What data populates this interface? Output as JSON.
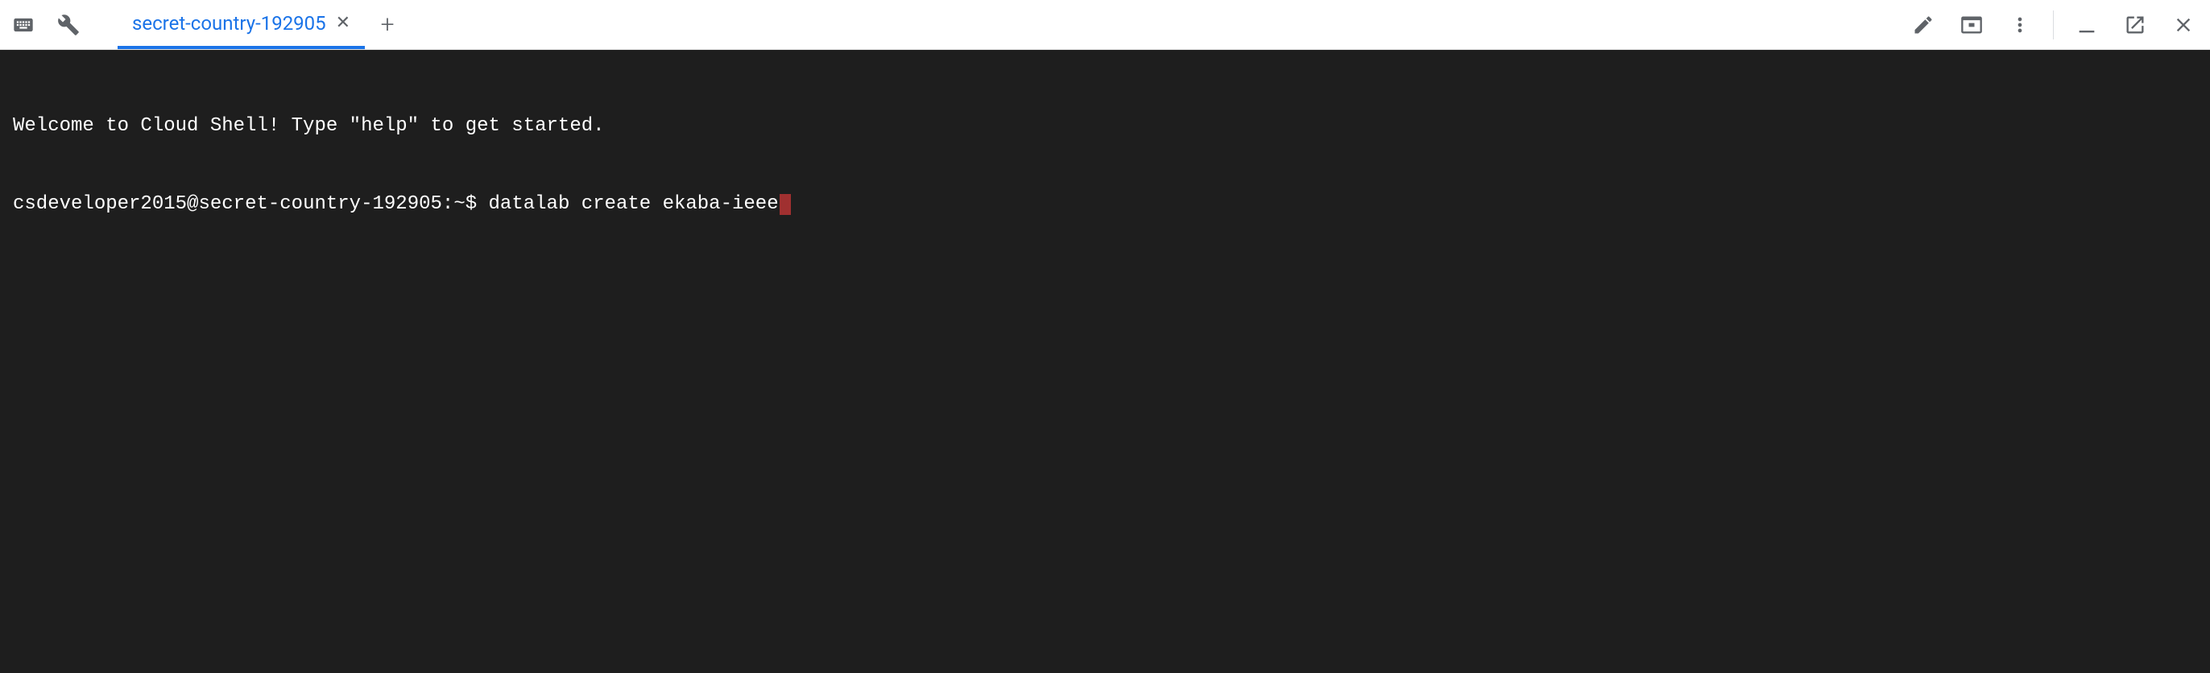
{
  "toolbar": {
    "icons": {
      "keyboard": "keyboard-icon",
      "wrench": "wrench-icon",
      "edit": "pencil-icon",
      "web_preview": "web-preview-icon",
      "more": "more-vert-icon",
      "minimize": "minimize-icon",
      "open_new": "open-in-new-window-icon",
      "close": "close-icon"
    }
  },
  "tabs": {
    "active": {
      "label": "secret-country-192905",
      "close_glyph": "✕"
    },
    "new_tab_glyph": "+"
  },
  "terminal": {
    "welcome_line": "Welcome to Cloud Shell! Type \"help\" to get started.",
    "prompt_user": "csdeveloper2015",
    "prompt_host": "secret-country-192905",
    "prompt_path": "~",
    "prompt_sep": "$",
    "command": "datalab create ekaba-ieee"
  },
  "colors": {
    "terminal_bg": "#1e1e1e",
    "terminal_fg": "#ffffff",
    "tab_active": "#1a73e8",
    "icon": "#5f6368",
    "cursor": "#a03030"
  }
}
